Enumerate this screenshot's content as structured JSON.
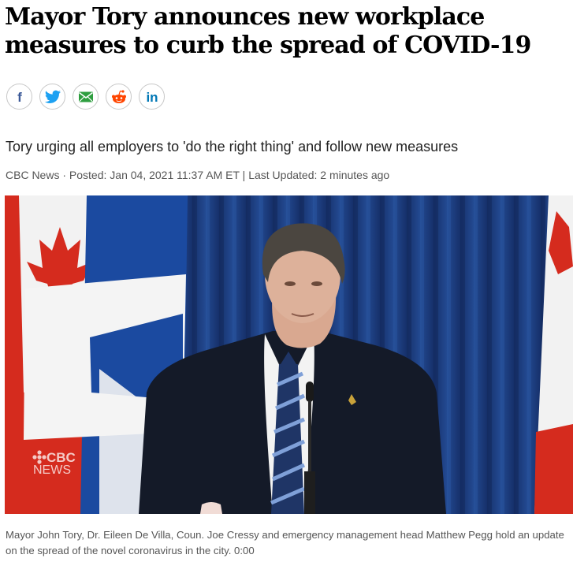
{
  "article": {
    "headline": "Mayor Tory announces new workplace measures to curb the spread of COVID-19",
    "deck": "Tory urging all employers to 'do the right thing' and follow new measures",
    "byline": {
      "source": "CBC News",
      "separator1": " · ",
      "posted": "Posted: Jan 04, 2021 11:37 AM ET",
      "separator2": " | ",
      "updated": "Last Updated: 2 minutes ago"
    },
    "caption": "Mayor John Tory, Dr. Eileen De Villa, Coun. Joe Cressy and emergency management head Matthew Pegg hold an update on the spread of the novel coronavirus in the city. 0:00"
  },
  "share": {
    "buttons": [
      {
        "icon": "facebook-icon",
        "glyph": "f",
        "color": "#3b5998"
      },
      {
        "icon": "twitter-icon",
        "color": "#1da1f2"
      },
      {
        "icon": "email-icon",
        "color": "#2e9e3f"
      },
      {
        "icon": "reddit-icon",
        "color": "#ff4500"
      },
      {
        "icon": "linkedin-icon",
        "glyph": "in",
        "color": "#0077b5"
      }
    ]
  },
  "video": {
    "watermark_line1": "CBC",
    "watermark_line2": "NEWS"
  },
  "colors": {
    "curtain": "#1d3b78",
    "flag_red": "#d52b1e",
    "toronto_blue": "#1b4aa0"
  }
}
